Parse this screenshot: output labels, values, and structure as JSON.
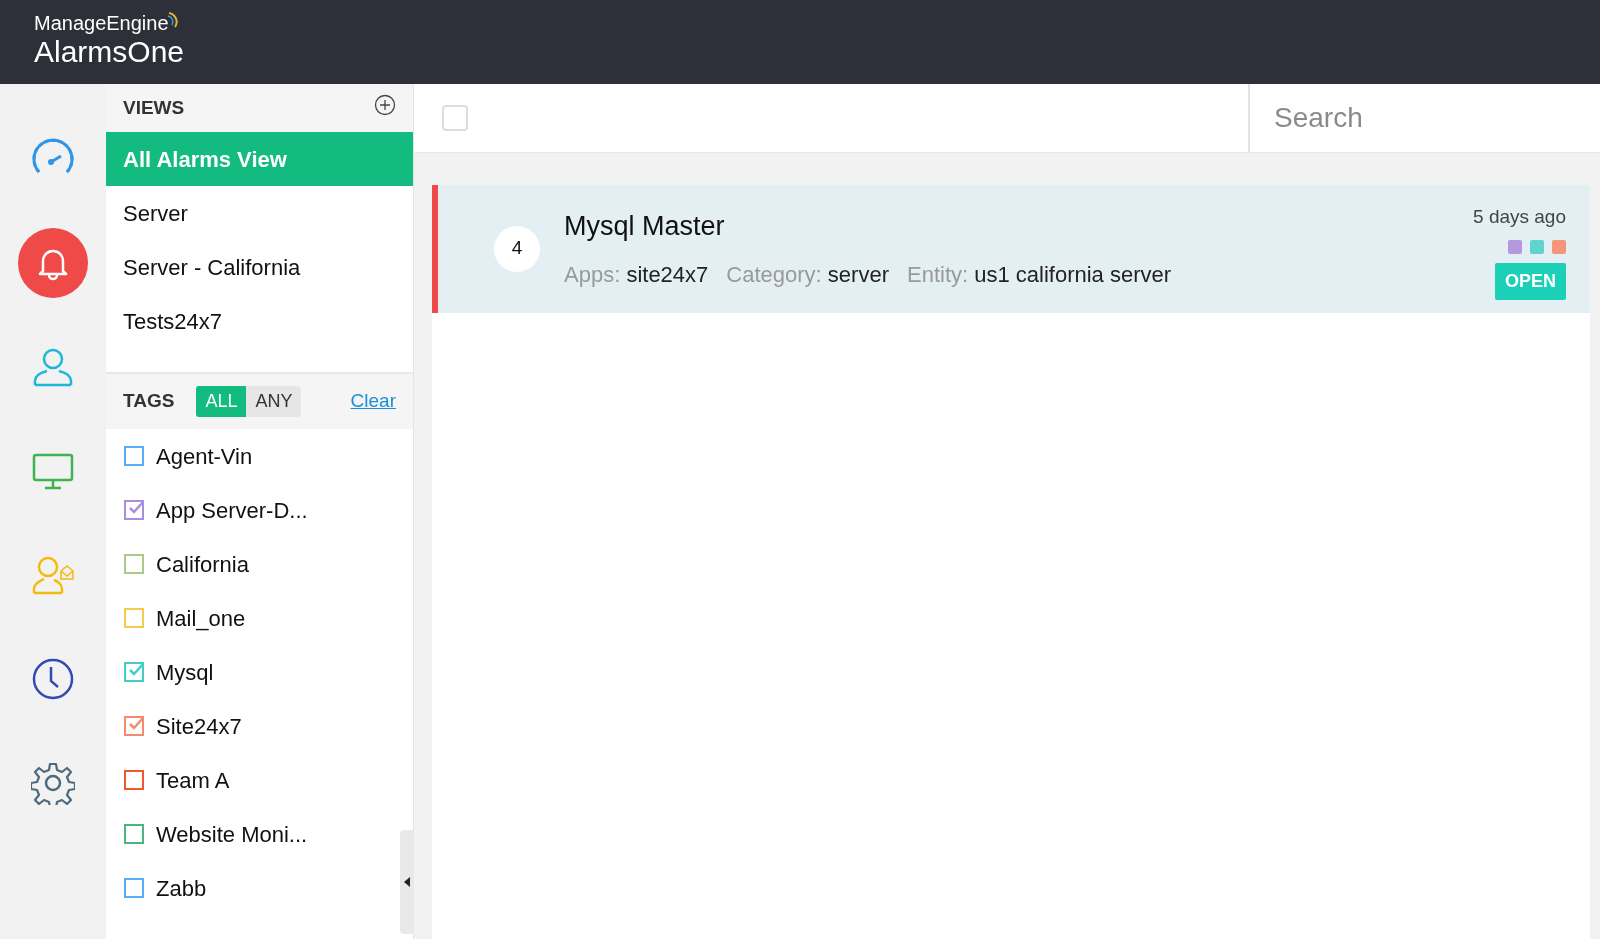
{
  "header": {
    "brand": "ManageEngine",
    "product": "AlarmsOne"
  },
  "nav": [
    {
      "kind": "dashboard",
      "selected": false
    },
    {
      "kind": "alarms",
      "selected": true
    },
    {
      "kind": "users",
      "selected": false
    },
    {
      "kind": "monitors",
      "selected": false
    },
    {
      "kind": "contacts",
      "selected": false
    },
    {
      "kind": "history",
      "selected": false
    },
    {
      "kind": "settings",
      "selected": false
    }
  ],
  "views": {
    "title": "VIEWS",
    "items": [
      {
        "label": "All Alarms View",
        "selected": true
      },
      {
        "label": "Server",
        "selected": false
      },
      {
        "label": "Server - California",
        "selected": false
      },
      {
        "label": "Tests24x7",
        "selected": false
      }
    ]
  },
  "tags": {
    "title": "TAGS",
    "modes": [
      {
        "label": "ALL",
        "selected": true
      },
      {
        "label": "ANY",
        "selected": false
      }
    ],
    "clear": "Clear",
    "items": [
      {
        "label": "Agent-Vin",
        "color": "#5aaef5",
        "checked": false
      },
      {
        "label": "App Server-D...",
        "color": "#a98ee0",
        "checked": true
      },
      {
        "label": "California",
        "color": "#a9c98a",
        "checked": false
      },
      {
        "label": "Mail_one",
        "color": "#f5cc4a",
        "checked": false
      },
      {
        "label": "Mysql",
        "color": "#3fcfc8",
        "checked": true
      },
      {
        "label": "Site24x7",
        "color": "#f58a6e",
        "checked": true
      },
      {
        "label": "Team A",
        "color": "#f4572e",
        "checked": false
      },
      {
        "label": "Website Moni...",
        "color": "#4cb57e",
        "checked": false
      },
      {
        "label": "Zabb",
        "color": "#5aaef5",
        "checked": false
      }
    ]
  },
  "toolbar": {
    "select_all": false,
    "search": {
      "placeholder": "Search"
    }
  },
  "alarms": [
    {
      "count": "4",
      "title": "Mysql Master",
      "time": "5 days ago",
      "status": "OPEN",
      "color": "#f04a48",
      "fields": [
        {
          "label": "Apps:",
          "value": "site24x7"
        },
        {
          "label": "Category:",
          "value": "server"
        },
        {
          "label": "Entity:",
          "value": "us1 california server"
        }
      ],
      "tags": [
        {
          "color": "#b39ae0"
        },
        {
          "color": "#5fd3cc"
        },
        {
          "color": "#f5957a"
        }
      ]
    }
  ]
}
